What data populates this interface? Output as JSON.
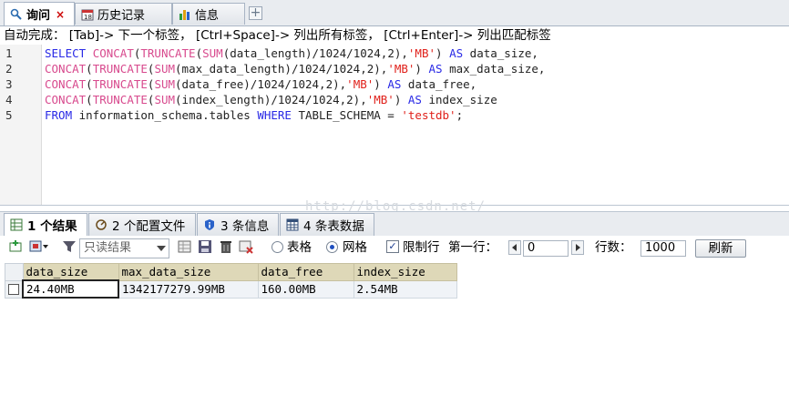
{
  "tabs": [
    {
      "label": "询问",
      "close": "×"
    },
    {
      "label": "历史记录"
    },
    {
      "label": "信息"
    }
  ],
  "new_tab": "+",
  "hint": "自动完成： [Tab]-> 下一个标签， [Ctrl+Space]-> 列出所有标签， [Ctrl+Enter]-> 列出匹配标签",
  "editor": {
    "line_numbers": [
      "1",
      "2",
      "3",
      "4",
      "5"
    ],
    "lines": [
      [
        {
          "t": "SELECT ",
          "c": "kw"
        },
        {
          "t": "CONCAT",
          "c": "fn"
        },
        {
          "t": "(",
          "c": ""
        },
        {
          "t": "TRUNCATE",
          "c": "fn"
        },
        {
          "t": "(",
          "c": ""
        },
        {
          "t": "SUM",
          "c": "fn"
        },
        {
          "t": "(data_length)/1024/1024,2),",
          "c": ""
        },
        {
          "t": "'MB'",
          "c": "st"
        },
        {
          "t": ") ",
          "c": ""
        },
        {
          "t": "AS",
          "c": "kw"
        },
        {
          "t": " data_size,",
          "c": ""
        }
      ],
      [
        {
          "t": "CONCAT",
          "c": "fn"
        },
        {
          "t": "(",
          "c": ""
        },
        {
          "t": "TRUNCATE",
          "c": "fn"
        },
        {
          "t": "(",
          "c": ""
        },
        {
          "t": "SUM",
          "c": "fn"
        },
        {
          "t": "(max_data_length)/1024/1024,2),",
          "c": ""
        },
        {
          "t": "'MB'",
          "c": "st"
        },
        {
          "t": ") ",
          "c": ""
        },
        {
          "t": "AS",
          "c": "kw"
        },
        {
          "t": " max_data_size,",
          "c": ""
        }
      ],
      [
        {
          "t": "CONCAT",
          "c": "fn"
        },
        {
          "t": "(",
          "c": ""
        },
        {
          "t": "TRUNCATE",
          "c": "fn"
        },
        {
          "t": "(",
          "c": ""
        },
        {
          "t": "SUM",
          "c": "fn"
        },
        {
          "t": "(data_free)/1024/1024,2),",
          "c": ""
        },
        {
          "t": "'MB'",
          "c": "st"
        },
        {
          "t": ") ",
          "c": ""
        },
        {
          "t": "AS",
          "c": "kw"
        },
        {
          "t": " data_free,",
          "c": ""
        }
      ],
      [
        {
          "t": "CONCAT",
          "c": "fn"
        },
        {
          "t": "(",
          "c": ""
        },
        {
          "t": "TRUNCATE",
          "c": "fn"
        },
        {
          "t": "(",
          "c": ""
        },
        {
          "t": "SUM",
          "c": "fn"
        },
        {
          "t": "(index_length)/1024/1024,2),",
          "c": ""
        },
        {
          "t": "'MB'",
          "c": "st"
        },
        {
          "t": ") ",
          "c": ""
        },
        {
          "t": "AS",
          "c": "kw"
        },
        {
          "t": " index_size",
          "c": ""
        }
      ],
      [
        {
          "t": "FROM",
          "c": "kw"
        },
        {
          "t": " information_schema.tables ",
          "c": ""
        },
        {
          "t": "WHERE",
          "c": "kw"
        },
        {
          "t": " TABLE_SCHEMA = ",
          "c": ""
        },
        {
          "t": "'testdb'",
          "c": "st"
        },
        {
          "t": ";",
          "c": ""
        }
      ]
    ]
  },
  "watermark": "http://blog.csdn.net/",
  "result_tabs": [
    {
      "label": "1 个结果"
    },
    {
      "label": "2 个配置文件"
    },
    {
      "label": "3 条信息"
    },
    {
      "label": "4 条表数据"
    }
  ],
  "toolbar": {
    "mode_select": "只读结果",
    "radio_table": "表格",
    "radio_grid": "网格",
    "limit_label": "限制行",
    "limit_checked": "✓",
    "first_row_label": "第一行：",
    "first_row_value": "0",
    "rows_label": "行数：",
    "rows_value": "1000",
    "refresh": "刷新"
  },
  "grid": {
    "columns": [
      "data_size",
      "max_data_size",
      "data_free",
      "index_size"
    ],
    "rows": [
      [
        "24.40MB",
        "1342177279.99MB",
        "160.00MB",
        "2.54MB"
      ]
    ]
  }
}
